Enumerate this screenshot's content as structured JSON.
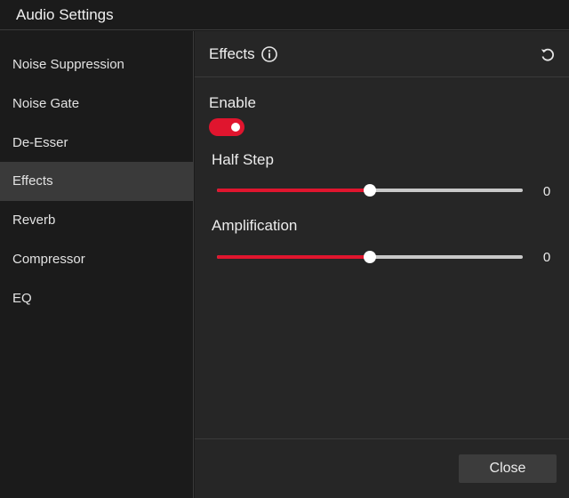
{
  "window": {
    "title": "Audio Settings"
  },
  "sidebar": {
    "items": [
      {
        "label": "Noise Suppression"
      },
      {
        "label": "Noise Gate"
      },
      {
        "label": "De-Esser"
      },
      {
        "label": "Effects",
        "selected": true
      },
      {
        "label": "Reverb"
      },
      {
        "label": "Compressor"
      },
      {
        "label": "EQ"
      }
    ]
  },
  "panel": {
    "title": "Effects",
    "info_icon": "info-icon",
    "reset_icon": "reset-icon",
    "enable": {
      "label": "Enable",
      "on": true
    },
    "half_step": {
      "label": "Half Step",
      "value": "0",
      "fill_fraction": 0.5
    },
    "amplification": {
      "label": "Amplification",
      "value": "0",
      "fill_fraction": 0.5
    }
  },
  "footer": {
    "close_label": "Close"
  },
  "colors": {
    "accent": "#e0152e",
    "background": "#1b1b1b",
    "panel": "#262626",
    "selected": "#3a3a3a"
  }
}
